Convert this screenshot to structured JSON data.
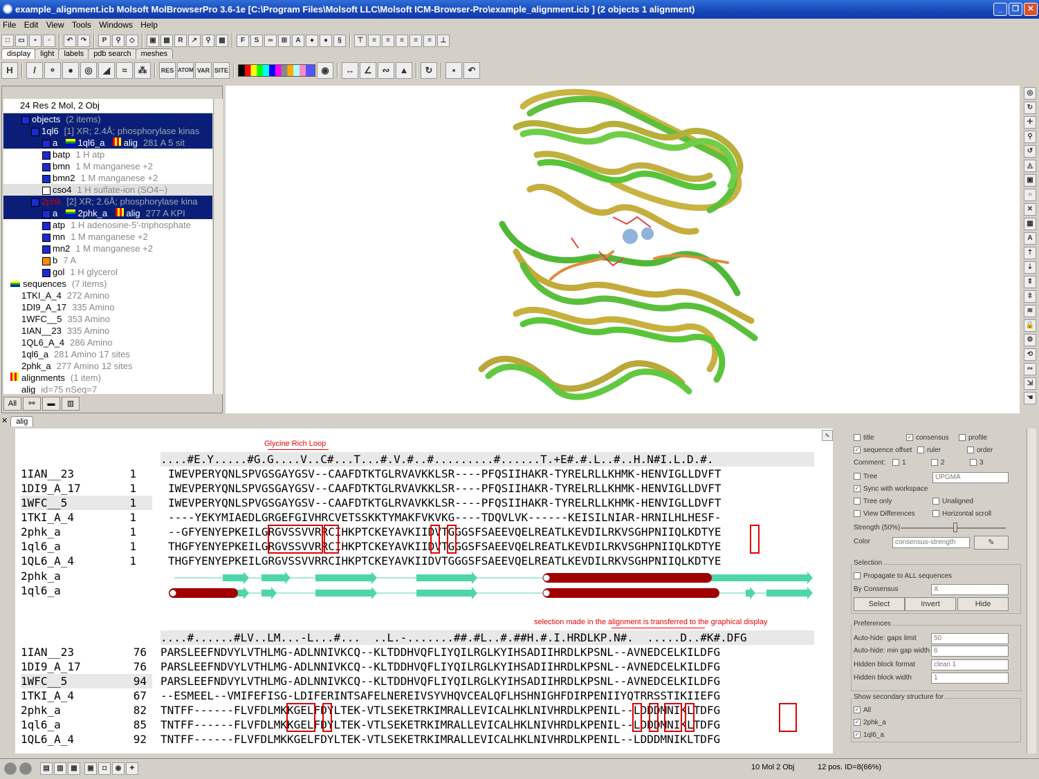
{
  "window": {
    "title": "example_alignment.icb Molsoft MolBrowserPro 3.6-1e  [C:\\Program Files\\Molsoft LLC\\Molsoft ICM-Browser-Pro\\example_alignment.icb ] (2 objects 1 alignment)"
  },
  "menu": [
    "File",
    "Edit",
    "View",
    "Tools",
    "Windows",
    "Help"
  ],
  "top_tabs": [
    "display",
    "light",
    "labels",
    "pdb search",
    "meshes"
  ],
  "tree": {
    "header": "24 Res 2 Mol, 2 Obj",
    "rows": [
      {
        "label": "objects",
        "extra": "(2 items)"
      },
      {
        "label": "1ql6",
        "extra": "[1] XR; 2.4Å; phosphorylase kinas"
      },
      {
        "label": "a",
        "extra2": "1ql6_a",
        "extra3": "alig",
        "extra": "281 A  5 sit"
      },
      {
        "label": "batp",
        "extra": "1 H   atp"
      },
      {
        "label": "bmn",
        "extra": "1 M   manganese +2"
      },
      {
        "label": "bmn2",
        "extra": "1 M   manganese +2"
      },
      {
        "label": "cso4",
        "extra": "1 H   sulfate-ion (SO4--)"
      },
      {
        "label": "2phk",
        "extra": "[2] XR; 2.6Å; phosphorylase kina"
      },
      {
        "label": "a",
        "extra2": "2phk_a",
        "extra3": "alig",
        "extra": "277 A  KPI"
      },
      {
        "label": "atp",
        "extra": "1 H   adenosine-5'-triphosphate"
      },
      {
        "label": "mn",
        "extra": "1 M   manganese +2"
      },
      {
        "label": "mn2",
        "extra": "1 M   manganese +2"
      },
      {
        "label": "b",
        "extra": "7 A"
      },
      {
        "label": "gol",
        "extra": "1 H   glycerol"
      },
      {
        "label": "sequences",
        "extra": "(7 items)"
      },
      {
        "label": "1TKI_A_4",
        "extra": "272 Amino"
      },
      {
        "label": "1DI9_A_17",
        "extra": "335 Amino"
      },
      {
        "label": "1WFC__5",
        "extra": "353 Amino"
      },
      {
        "label": "1IAN__23",
        "extra": "335 Amino"
      },
      {
        "label": "1QL6_A_4",
        "extra": "286 Amino"
      },
      {
        "label": "1ql6_a",
        "extra": "281 Amino 17 sites"
      },
      {
        "label": "2phk_a",
        "extra": "277 Amino 12 sites"
      },
      {
        "label": "alignments",
        "extra": "(1 item)"
      },
      {
        "label": "alig",
        "extra": "id=75 nSeq=7"
      }
    ],
    "bottom_tabs": [
      "All",
      "",
      "",
      ""
    ]
  },
  "seq_tab": "alig",
  "annotations": {
    "loop": "Glycine Rich Loop",
    "selection_note": "selection made in the alignment is transferred to the graphical display"
  },
  "block1": {
    "consensus": "....#E.Y.....#G.G....V..C#...T...#.V.#..#.........#......T.+E#.#.L..#..H.N#I.L.D.#.",
    "rows": [
      {
        "name": "1IAN__23",
        "start": "1",
        "seq": "IWEVPERYQNLSPVGSGAYGSV--CAAFDTKTGLRVAVKKLSR----PFQSIIHAKR-TYRELRLLKHMK-HENVIGLLDVFT"
      },
      {
        "name": "1DI9_A_17",
        "start": "1",
        "seq": "IWEVPERYQNLSPVGSGAYGSV--CAAFDTKTGLRVAVKKLSR----PFQSIIHAKR-TYRELRLLKHMK-HENVIGLLDVFT"
      },
      {
        "name": "1WFC__5",
        "start": "1",
        "seq": "IWEVPERYQNLSPVGSGAYGSV--CAAFDTKTGLRVAVKKLSR----PFQSIIHAKR-TYRELRLLKHMK-HENVIGLLDVFT"
      },
      {
        "name": "1TKI_A_4",
        "start": "1",
        "seq": "----YEKYMIAEDLGRGEFGIVHRCVETSSKKTYMAKFVKVKG----TDQVLVK------KEISILNIAR-HRNILHLHESF-"
      },
      {
        "name": "2phk_a",
        "start": "1",
        "seq": "--GFYENYEPKEILGRGVSSVVRRCIHKPTCKEYAVKIIDVTGGGSFSAEEVQELREATLKEVDILRKVSGHPNIIQLKDTYE"
      },
      {
        "name": "1ql6_a",
        "start": "1",
        "seq": "THGFYENYEPKEILGRGVSSVVRRCIHKPTCKEYAVKIIDVTGGGSFSAEEVQELREATLKEVDILRKVSGHPNIIQLKDTYE"
      },
      {
        "name": "1QL6_A_4",
        "start": "1",
        "seq": "THGFYENYEPKEILGRGVSSVVRRCIHKPTCKEYAVKIIDVTGGGSFSAEEVQELREATLKEVDILRKVSGHPNIIQLKDTYE"
      }
    ],
    "ss_names": [
      "2phk_a",
      "1ql6_a"
    ]
  },
  "block2": {
    "consensus": "....#......#LV..LM...-L...#...  ..L.-.......##.#L..#.##H.#.I.HRDLKP.N#.  .....D..#K#.DFG",
    "rows": [
      {
        "name": "1IAN__23",
        "start": "76",
        "seq": "PARSLEEFNDVYLVTHLMG-ADLNNIVKCQ--KLTDDHVQFLIYQILRGLKYIHSADIIHRDLKPSNL--AVNEDCELKILDFG"
      },
      {
        "name": "1DI9_A_17",
        "start": "76",
        "seq": "PARSLEEFNDVYLVTHLMG-ADLNNIVKCQ--KLTDDHVQFLIYQILRGLKYIHSADIIHRDLKPSNL--AVNEDCELKILDFG"
      },
      {
        "name": "1WFC__5",
        "start": "94",
        "seq": "PARSLEEFNDVYLVTHLMG-ADLNNIVKCQ--KLTDDHVQFLIYQILRGLKYIHSADIIHRDLKPSNL--AVNEDCELKILDFG"
      },
      {
        "name": "1TKI_A_4",
        "start": "67",
        "seq": "--ESMEEL--VMIFEFISG-LDIFERINTSAFELNEREIVSYVHQVCEALQFLHSHNIGHFDIRPENIIYQTRRSSTIKIIEFG"
      },
      {
        "name": "2phk_a",
        "start": "82",
        "seq": "TNTFF------FLVFDLMKKGELFDYLTEK-VTLSEKETRKIMRALLEVICALHKLNIVHRDLKPENIL--LDDDMNIKLTDFG"
      },
      {
        "name": "1ql6_a",
        "start": "85",
        "seq": "TNTFF------FLVFDLMKKGELFDYLTEK-VTLSEKETRKIMRALLEVICALHKLNIVHRDLKPENIL--LDDDMNIKLTDFG"
      },
      {
        "name": "1QL6_A_4",
        "start": "92",
        "seq": "TNTFF------FLVFDLMKKGELFDYLTEK-VTLSEKETRKIMRALLEVICALHKLNIVHRDLKPENIL--LDDDMNIKLTDFG"
      }
    ]
  },
  "options": {
    "view_options": {
      "title": "title",
      "consensus": "consensus",
      "profile": "profile",
      "sequence_offset": "sequence offset",
      "ruler": "ruler",
      "order": "order",
      "comment": "Comment:",
      "c1": "1",
      "c2": "2",
      "c3": "3",
      "tree": "Tree",
      "tree_method": "UPGMA",
      "sync": "Sync with workspace",
      "tree_only": "Tree only",
      "unaligned": "Unaligned",
      "view_differences": "View Differences",
      "horizontal_scroll": "Horizontal scroll",
      "strength": "Strength (50%)",
      "color": "Color",
      "color_value": "consensus-strength"
    },
    "selection": {
      "header": "Selection",
      "propagate": "Propagate to ALL sequences",
      "by_consensus": "By Consensus",
      "by_consensus_value": "X",
      "select": "Select",
      "invert": "Invert",
      "hide": "Hide"
    },
    "preferences": {
      "header": "Preferences",
      "gaps_limit": "Auto-hide: gaps limit",
      "gaps_limit_value": "50",
      "min_gap_width": "Auto-hide: min gap width",
      "min_gap_width_value": "6",
      "hidden_block_format": "Hidden block format",
      "hidden_block_format_value": "clean 1",
      "hidden_block_width": "Hidden block width",
      "hidden_block_width_value": "1"
    },
    "secondary": {
      "header": "Show secondary structure for",
      "all": "All",
      "s1": "2phk_a",
      "s2": "1ql6_a"
    }
  },
  "status": {
    "mols": "10 Mol 2 Obj",
    "pos": "12 pos. ID=8(66%)"
  },
  "colors": {
    "helix": "#a00000",
    "strand": "#4fd6a8",
    "dark_green": "#1fb37a",
    "light_green": "#e6f7b8",
    "mid_green": "#86ef8c",
    "blue_hl": "#a9bfd8"
  }
}
